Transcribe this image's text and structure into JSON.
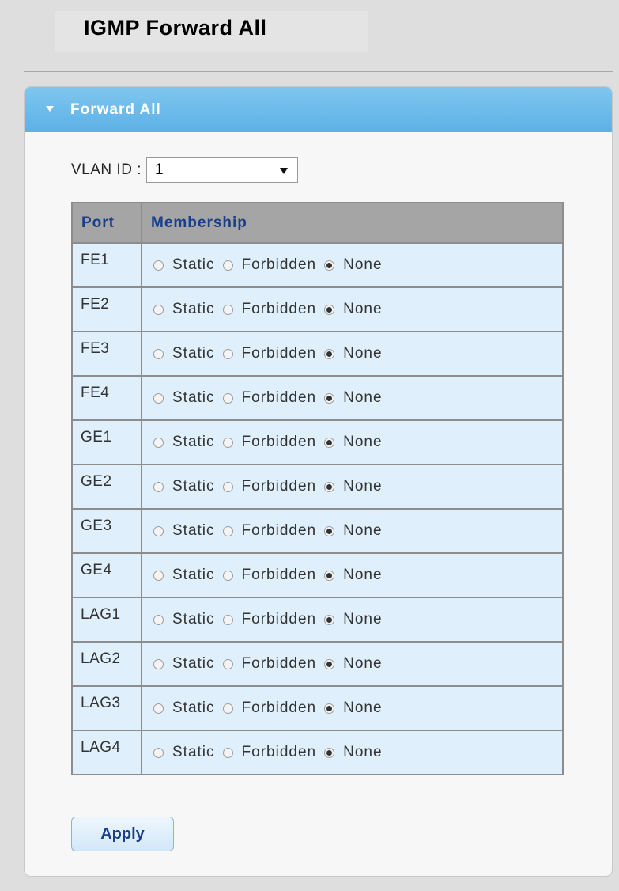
{
  "page_title": "IGMP Forward All",
  "panel": {
    "title": "Forward All",
    "vlan_label": "VLAN ID :",
    "vlan_value": "1"
  },
  "table": {
    "headers": {
      "port": "Port",
      "membership": "Membership"
    },
    "option_labels": [
      "Static",
      "Forbidden",
      "None"
    ],
    "rows": [
      {
        "port": "FE1",
        "selected": "None"
      },
      {
        "port": "FE2",
        "selected": "None"
      },
      {
        "port": "FE3",
        "selected": "None"
      },
      {
        "port": "FE4",
        "selected": "None"
      },
      {
        "port": "GE1",
        "selected": "None"
      },
      {
        "port": "GE2",
        "selected": "None"
      },
      {
        "port": "GE3",
        "selected": "None"
      },
      {
        "port": "GE4",
        "selected": "None"
      },
      {
        "port": "LAG1",
        "selected": "None"
      },
      {
        "port": "LAG2",
        "selected": "None"
      },
      {
        "port": "LAG3",
        "selected": "None"
      },
      {
        "port": "LAG4",
        "selected": "None"
      }
    ]
  },
  "apply_label": "Apply",
  "colors": {
    "header_blue": "#5cb1e6",
    "table_header_gray": "#a5a5a5",
    "row_bg": "#dfeffb",
    "link_blue": "#1a3f8a"
  }
}
